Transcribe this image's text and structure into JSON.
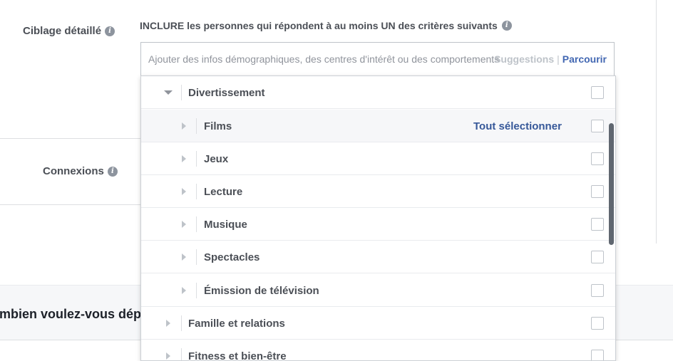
{
  "targeting": {
    "label": "Ciblage détaillé",
    "include_text": "INCLURE les personnes qui répondent à au moins UN des critères suivants",
    "search_placeholder": "Ajouter des infos démographiques, des centres d'intérêt ou des comportements",
    "suggestions_label": "Suggestions",
    "separator": "|",
    "browse_label": "Parcourir"
  },
  "connections": {
    "label": "Connexions"
  },
  "budget": {
    "title": "ombien voulez-vous dépenser ?"
  },
  "dropdown": {
    "select_all_label": "Tout sélectionner",
    "items": [
      {
        "label": "Divertissement",
        "level": 0,
        "expanded": true
      },
      {
        "label": "Films",
        "level": 1,
        "hovered": true
      },
      {
        "label": "Jeux",
        "level": 1
      },
      {
        "label": "Lecture",
        "level": 1
      },
      {
        "label": "Musique",
        "level": 1
      },
      {
        "label": "Spectacles",
        "level": 1
      },
      {
        "label": "Émission de télévision",
        "level": 1
      },
      {
        "label": "Famille et relations",
        "level": 0
      },
      {
        "label": "Fitness et bien-être",
        "level": 0
      }
    ]
  },
  "colors": {
    "link": "#4267b2",
    "text": "#4b4f56",
    "border": "#dddfe2",
    "band": "#f6f7f9"
  }
}
